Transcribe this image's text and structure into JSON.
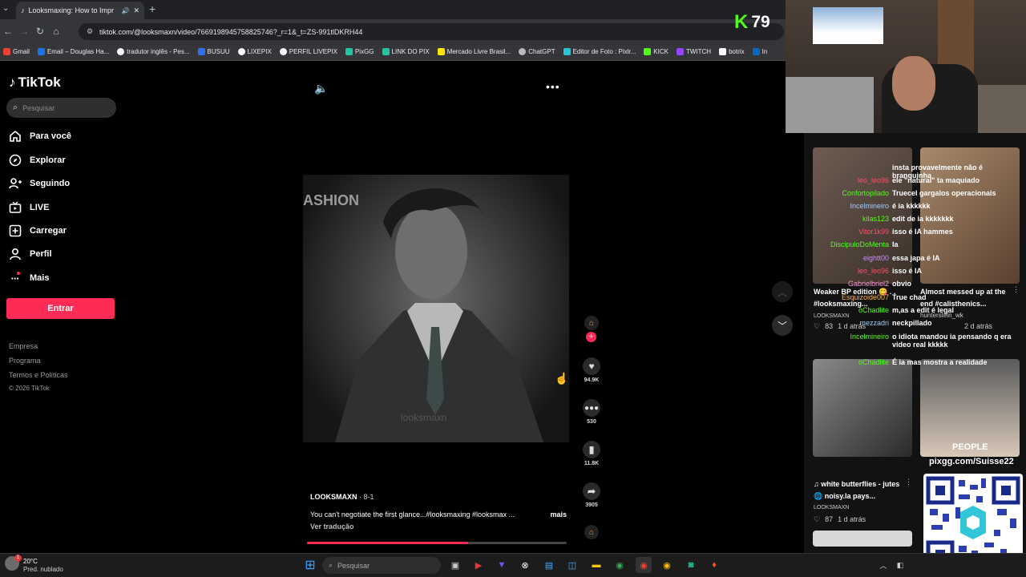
{
  "browser": {
    "tab_title": "Looksmaxing: How to Impr",
    "url": "tiktok.com/@looksmaxn/video/7669198945758825746?_r=1&_t=ZS-991tlDKRH44",
    "bookmarks": [
      "Gmail",
      "Email – Douglas Ha...",
      "tradutor inglês - Pes...",
      "BUSUU",
      "LIXEPIX",
      "PERFIL LIVEPIX",
      "PixGG",
      "LINK DO PIX",
      "Mercado Livre Brasil...",
      "ChatGPT",
      "Editor de Foto : Pixlr...",
      "KICK",
      "TWITCH",
      "botrix",
      "In"
    ]
  },
  "tiktok": {
    "logo": "TikTok",
    "search_placeholder": "Pesquisar",
    "menu": [
      {
        "label": "Para você",
        "icon": "home-icon"
      },
      {
        "label": "Explorar",
        "icon": "compass-icon"
      },
      {
        "label": "Seguindo",
        "icon": "following-icon"
      },
      {
        "label": "LIVE",
        "icon": "live-icon"
      },
      {
        "label": "Carregar",
        "icon": "upload-icon"
      },
      {
        "label": "Perfil",
        "icon": "profile-icon"
      },
      {
        "label": "Mais",
        "icon": "more-dots-icon"
      }
    ],
    "login_button": "Entrar",
    "footer": [
      "Empresa",
      "Programa",
      "Termos e Políticas",
      "© 2026 TikTok"
    ],
    "video": {
      "watermark_top": "ASHION",
      "watermark_bottom": "looksmaxn",
      "author": "LOOKSMAXN",
      "date": "· 8-1",
      "caption": "You can't negotiate the first glance...#looksmaxing #looksmax ...",
      "more": "mais",
      "translate": "Ver tradução",
      "progress": 0.62,
      "likes": "94.9K",
      "comments": "530",
      "saves": "11.8K",
      "shares": "3905"
    }
  },
  "stream": {
    "kick_count": "79",
    "pix_url": "pixgg.com/Suisse22",
    "chat": [
      {
        "user": "",
        "msg": "insta provavelmente não é branquinha",
        "color": "#53fc18"
      },
      {
        "user": "leo_leo96",
        "msg": "ele \"natural\" ta maquiado",
        "color": "#ff4d6d"
      },
      {
        "user": "Confortopilado",
        "msg": "Truecel gargalos operacionais",
        "color": "#53fc18"
      },
      {
        "user": "Incelmineiro",
        "msg": "é ia kkkkkk",
        "color": "#9ecbff"
      },
      {
        "user": "kilas123",
        "msg": "edit de ia kkkkkkk",
        "color": "#53fc18"
      },
      {
        "user": "Vitor1k99",
        "msg": "isso é IA hammes",
        "color": "#ff4d6d"
      },
      {
        "user": "DiscipuloDoMenta",
        "msg": "Ia",
        "color": "#53fc18"
      },
      {
        "user": "eightt00",
        "msg": "essa japa é IA",
        "color": "#c58cff"
      },
      {
        "user": "leo_leo96",
        "msg": "isso é IA",
        "color": "#ff4d6d"
      },
      {
        "user": "Gabrielbriel2",
        "msg": "obvio",
        "color": "#ff9ad5"
      },
      {
        "user": "Esquizoide007",
        "msg": "True chad",
        "color": "#ffb347"
      },
      {
        "user": "oChadlite",
        "msg": "m,as a edit é legal",
        "color": "#53fc18"
      },
      {
        "user": "mezzadri",
        "msg": "neckpillado",
        "color": "#9ecbff"
      },
      {
        "user": "Incelmineiro",
        "msg": "o idiota mandou ia pensando q era video real kkkkk",
        "color": "#53fc18"
      },
      {
        "user": "oChadlite",
        "msg": "É ia mas mostra a realidade",
        "color": "#53fc18"
      }
    ],
    "cards": [
      {
        "title": "Weaker BP edition 😋 . . #looksmaxing...",
        "author": "LOOKSMAXN",
        "likes": "83",
        "age": "1 d atrás"
      },
      {
        "title": "Almost messed up at the end #calisthenics...",
        "author": "hunterstein_wk",
        "likes": "",
        "age": "2 d atrás"
      },
      {
        "title": "♫ white butterflies - jutes 🌐 noisy.la pays...",
        "author": "LOOKSMAXN",
        "likes": "87",
        "age": "1 d atrás"
      }
    ],
    "card_thumb_text": "PEOPLE"
  },
  "taskbar": {
    "weather_temp": "20°C",
    "weather_desc": "Pred. nublado",
    "search_placeholder": "Pesquisar"
  }
}
